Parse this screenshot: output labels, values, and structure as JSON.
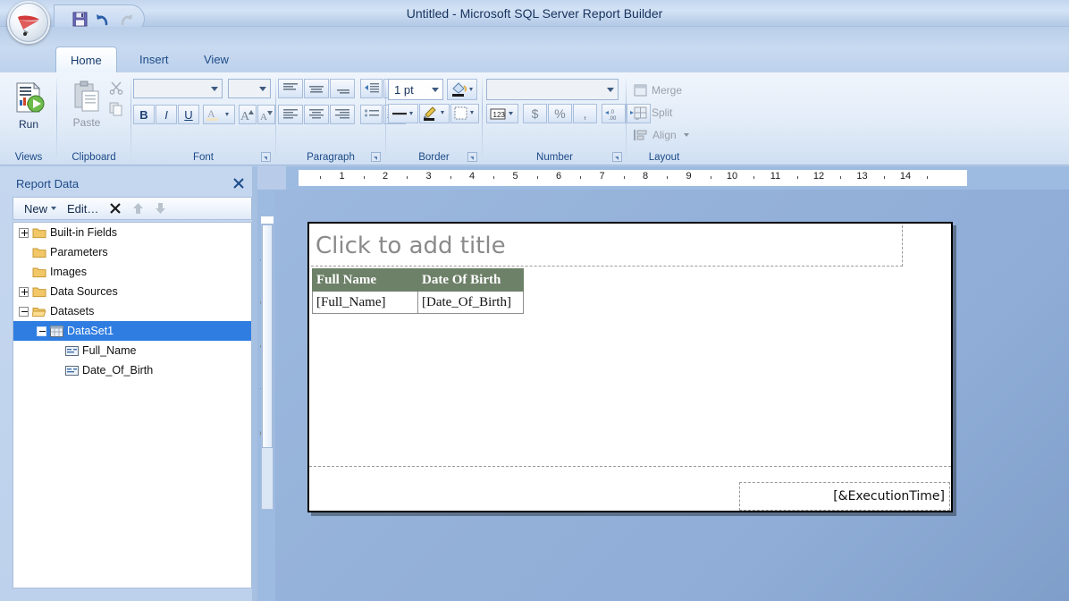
{
  "window": {
    "title": "Untitled - Microsoft SQL Server Report Builder",
    "orb_icon": "report-builder-orb-icon"
  },
  "quick_access": {
    "items": [
      {
        "name": "save-icon",
        "label": "Save"
      },
      {
        "name": "undo-icon",
        "label": "Undo"
      },
      {
        "name": "redo-icon",
        "label": "Redo"
      }
    ]
  },
  "ribbon": {
    "tabs": [
      {
        "label": "Home",
        "active": true
      },
      {
        "label": "Insert",
        "active": false
      },
      {
        "label": "View",
        "active": false
      }
    ],
    "groups": {
      "views": {
        "label": "Views",
        "run_label": "Run",
        "run_icon": "run-report-icon"
      },
      "clipboard": {
        "label": "Clipboard",
        "paste_label": "Paste",
        "paste_icon": "paste-icon",
        "cut_icon": "cut-scissors-icon",
        "copy_icon": "copy-icon"
      },
      "font": {
        "label": "Font",
        "font_name_value": "",
        "font_size_value": "",
        "bold_label": "B",
        "italic_label": "I",
        "underline_label": "U",
        "font_color_icon": "font-color-icon",
        "grow_font_icon": "grow-font-icon",
        "shrink_font_icon": "shrink-font-icon"
      },
      "paragraph": {
        "label": "Paragraph",
        "buttons": [
          "align-top-left-icon",
          "align-top-center-icon",
          "align-bottom-right-icon",
          "decrease-indent-icon",
          "increase-indent-icon",
          "align-left-icon",
          "align-center-icon",
          "align-right-icon",
          "bullet-list-icon",
          "numbered-list-icon"
        ]
      },
      "border": {
        "label": "Border",
        "width_value": "1 pt",
        "fill_color_icon": "fill-color-icon",
        "line_style_icon": "line-style-icon",
        "border_color_icon": "border-color-icon",
        "borders_icon": "borders-icon"
      },
      "number": {
        "label": "Number",
        "format_value": "",
        "placeholder_style_label": "123",
        "currency_label": "$",
        "percent_label": "%",
        "comma_label": ",",
        "decrease_decimal_icon": "decrease-decimal-icon",
        "increase_decimal_icon": "increase-decimal-icon"
      },
      "layout": {
        "label": "Layout",
        "items": [
          {
            "label": "Merge",
            "icon": "merge-cells-icon",
            "disabled": true
          },
          {
            "label": "Split",
            "icon": "split-cells-icon",
            "disabled": true
          },
          {
            "label": "Align",
            "icon": "align-objects-icon",
            "disabled": true,
            "has_dropdown": true
          }
        ]
      }
    }
  },
  "report_data_panel": {
    "title": "Report Data",
    "close_icon": "close-icon",
    "toolbar": [
      {
        "label": "New",
        "name": "new-button",
        "has_dropdown": true
      },
      {
        "label": "Edit…",
        "name": "edit-button",
        "has_dropdown": false
      },
      {
        "label": "",
        "name": "delete-icon",
        "glyph": "×"
      },
      {
        "label": "",
        "name": "move-up-icon",
        "glyph": "▲"
      },
      {
        "label": "",
        "name": "move-down-icon",
        "glyph": "▼"
      }
    ],
    "tree": [
      {
        "label": "Built-in Fields",
        "icon": "folder-icon",
        "indent": 0,
        "expander": "plus",
        "selected": false
      },
      {
        "label": "Parameters",
        "icon": "folder-icon",
        "indent": 0,
        "expander": "none",
        "selected": false
      },
      {
        "label": "Images",
        "icon": "folder-icon",
        "indent": 0,
        "expander": "none",
        "selected": false
      },
      {
        "label": "Data Sources",
        "icon": "folder-icon",
        "indent": 0,
        "expander": "plus",
        "selected": false
      },
      {
        "label": "Datasets",
        "icon": "folder-open-icon",
        "indent": 0,
        "expander": "minus",
        "selected": false
      },
      {
        "label": "DataSet1",
        "icon": "dataset-icon",
        "indent": 1,
        "expander": "minus",
        "selected": true
      },
      {
        "label": "Full_Name",
        "icon": "field-icon",
        "indent": 2,
        "expander": "none",
        "selected": false
      },
      {
        "label": "Date_Of_Birth",
        "icon": "field-icon",
        "indent": 2,
        "expander": "none",
        "selected": false
      }
    ]
  },
  "rulers": {
    "horizontal_ticks": [
      "1",
      "2",
      "3",
      "4",
      "5",
      "6",
      "7",
      "8",
      "9",
      "10",
      "11",
      "12",
      "13",
      "14"
    ],
    "vertical_ticks": [
      "1",
      "2",
      "3",
      "4",
      "5"
    ],
    "unit": "inches"
  },
  "design_surface": {
    "title_placeholder": "Click to add title",
    "tablix": {
      "headers": [
        "Full Name",
        "Date Of Birth"
      ],
      "cells": [
        "[Full_Name]",
        "[Date_Of_Birth]"
      ],
      "header_background": "#6d8068",
      "header_text_color": "#ffffff"
    },
    "page_footer": {
      "execution_time_expression": "[&ExecutionTime]"
    }
  }
}
